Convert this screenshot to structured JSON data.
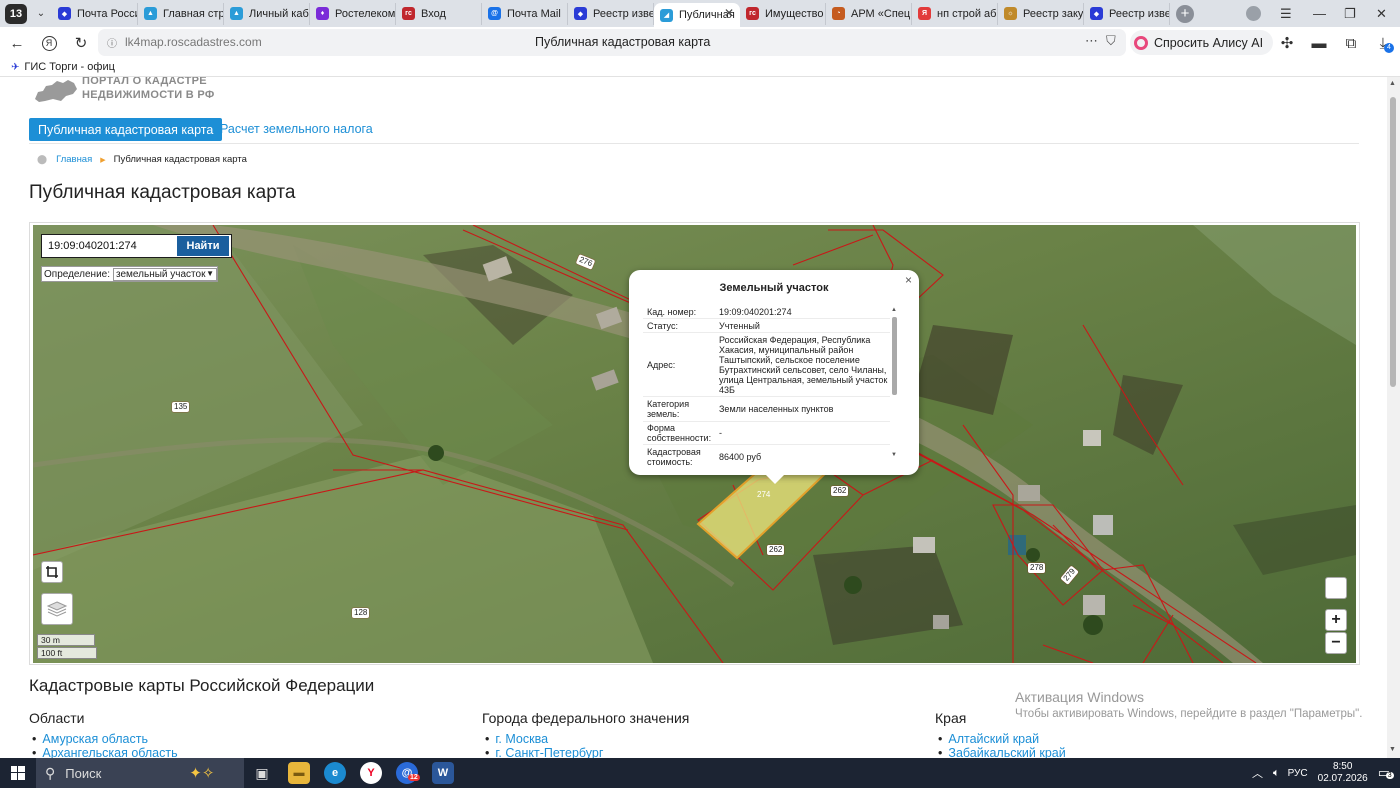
{
  "browser": {
    "tab_count": "13",
    "tabs": [
      {
        "label": "Почта России",
        "color": "#2a3bd6"
      },
      {
        "label": "Главная стр",
        "color": "#2b9cd8"
      },
      {
        "label": "Личный каб",
        "color": "#2b9cd8"
      },
      {
        "label": "Ростелеком",
        "color": "#7a2bd8"
      },
      {
        "label": "Вход",
        "color": "#c0272d"
      },
      {
        "label": "Почта Mail",
        "color": "#1a72e8"
      },
      {
        "label": "Реестр изве",
        "color": "#2a3bd6"
      },
      {
        "label": "Публичная",
        "color": "#2b9cd8",
        "active": true
      },
      {
        "label": "Имущество",
        "color": "#c0272d"
      },
      {
        "label": "АРМ «Спец",
        "color": "#c55b1f"
      },
      {
        "label": "нп строй аб",
        "color": "#e23b3b"
      },
      {
        "label": "Реестр заку",
        "color": "#c08a2a"
      },
      {
        "label": "Реестр изве",
        "color": "#2a3bd6"
      }
    ],
    "url": "lk4map.roscadastres.com",
    "page_title": "Публичная кадастровая карта",
    "alice_label": "Спросить Алису AI",
    "bookmark": "ГИС Торги - офиц",
    "download_badge": "4"
  },
  "page": {
    "logo_line1": "ПОРТАЛ О КАДАСТРЕ",
    "logo_line2": "НЕДВИЖИМОСТИ В РФ",
    "nav_map": "Публичная кадастровая карта",
    "nav_tax": "Расчет земельного налога",
    "crumb_home": "Главная",
    "crumb_current": "Публичная кадастровая карта",
    "h1": "Публичная кадастровая карта"
  },
  "map": {
    "search_value": "19:09:040201:274",
    "find_label": "Найти",
    "definition_label": "Определение:",
    "definition_value": "земельный участок",
    "scale_m": "30 m",
    "scale_ft": "100 ft",
    "zoom_in": "+",
    "zoom_out": "−",
    "parcel_labels": {
      "l276": "276",
      "l135": "135",
      "l128": "128",
      "l274": "274",
      "l262a": "262",
      "l262b": "262",
      "l278": "278",
      "l279": "279"
    },
    "popup": {
      "title": "Земельный участок",
      "close": "×",
      "rows": [
        {
          "k": "Кад. номер:",
          "v": "19:09:040201:274"
        },
        {
          "k": "Статус:",
          "v": "Учтенный"
        },
        {
          "k": "Адрес:",
          "v": "Российская Федерация, Республика Хакасия, муниципальный район Таштыпский, сельское поселение Бутрахтинский сельсовет, село Чиланы, улица Центральная, земельный участок 43Б"
        },
        {
          "k": "Категория земель:",
          "v": "Земли населенных пунктов"
        },
        {
          "k": "Форма собственности:",
          "v": "-"
        },
        {
          "k": "Кадастровая стоимость:",
          "v": "86400 руб"
        }
      ]
    }
  },
  "bottom": {
    "h2": "Кадастровые карты Российской Федерации",
    "col1_title": "Области",
    "col1_items": [
      "Амурская область",
      "Архангельская область"
    ],
    "col2_title": "Города федерального значения",
    "col2_items": [
      "г. Москва",
      "г. Санкт-Петербург"
    ],
    "col3_title": "Края",
    "col3_items": [
      "Алтайский край",
      "Забайкальский край"
    ],
    "activation_title": "Активация Windows",
    "activation_text": "Чтобы активировать Windows, перейдите в раздел \"Параметры\"."
  },
  "taskbar": {
    "search_placeholder": "Поиск",
    "lang": "РУС",
    "time": "8:50",
    "date": "02.07.2026",
    "notif_badge": "3",
    "mail_badge": "12"
  }
}
